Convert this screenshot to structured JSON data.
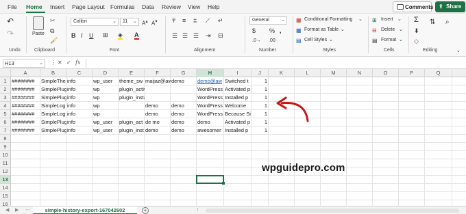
{
  "menu": {
    "tabs": [
      "File",
      "Home",
      "Insert",
      "Page Layout",
      "Formulas",
      "Data",
      "Review",
      "View",
      "Help"
    ],
    "active": "Home",
    "comments_label": "Comments",
    "share_label": "Share"
  },
  "ribbon": {
    "groups": {
      "undo": "Undo",
      "clipboard": "Clipboard",
      "font": "Font",
      "alignment": "Alignment",
      "number": "Number",
      "styles": "Styles",
      "cells": "Cells",
      "editing": "Editing"
    },
    "paste_label": "Paste",
    "font_name": "Calibri",
    "font_size": "11",
    "number_format": "General",
    "conditional_formatting": "Conditional Formatting",
    "format_as_table": "Format as Table",
    "cell_styles": "Cell Styles",
    "insert": "Insert",
    "delete": "Delete",
    "format": "Format"
  },
  "formula_bar": {
    "name_box": "H13",
    "fx": "fx",
    "content": ""
  },
  "grid": {
    "columns": [
      "A",
      "B",
      "C",
      "D",
      "E",
      "F",
      "G",
      "H",
      "I",
      "J",
      "K",
      "L",
      "M",
      "N",
      "O",
      "P",
      "Q"
    ],
    "rows": [
      "1",
      "2",
      "3",
      "4",
      "5",
      "6",
      "7",
      "8",
      "9",
      "10",
      "11",
      "12",
      "13",
      "14",
      "15",
      "16"
    ],
    "selected_cell": "H13",
    "data": [
      [
        "########",
        "SimpleThe",
        "info",
        "wp_user",
        "theme_sw",
        "maijaz@aw",
        "demo",
        "demo@aw",
        "Switched t",
        "1"
      ],
      [
        "########",
        "SimplePlug",
        "info",
        "wp",
        "plugin_activated",
        "",
        "",
        "WordPress",
        "Activated p",
        "1"
      ],
      [
        "########",
        "SimplePlug",
        "info",
        "wp",
        "plugin_installed",
        "",
        "",
        "WordPress",
        "Installed p",
        "1"
      ],
      [
        "########",
        "SimpleLog",
        "info",
        "wp",
        "",
        "demo",
        "demo",
        "WordPress",
        "Welcome",
        "1"
      ],
      [
        "########",
        "SimpleLog",
        "info",
        "wp",
        "",
        "demo",
        "demo",
        "WordPress",
        "Because Si",
        "1"
      ],
      [
        "########",
        "SimplePlug",
        "info",
        "wp_user",
        "plugin_act",
        "de mo",
        "demo",
        "demo",
        "Activated p",
        "1"
      ],
      [
        "########",
        "SimplePlug",
        "info",
        "wp_user",
        "plugin_inst",
        "demo",
        "demo",
        "awesomer",
        "Installed p",
        "1"
      ]
    ]
  },
  "watermark": "wpguidepro.com",
  "sheet_tab": "simple-history-export-167042602",
  "add_sheet": "+",
  "icons": {
    "undo": "undo-icon",
    "redo": "redo-icon",
    "paste": "clipboard-icon",
    "cut": "scissors-icon",
    "copy": "copy-icon",
    "format_painter": "format-painter-icon",
    "sum": "sum-icon",
    "sort": "sort-filter-icon",
    "find": "find-icon",
    "arrow": "red-arrow-annotation"
  },
  "colors": {
    "accent": "#1e7145",
    "link": "#1f5fb4",
    "annotation": "#c81414"
  }
}
